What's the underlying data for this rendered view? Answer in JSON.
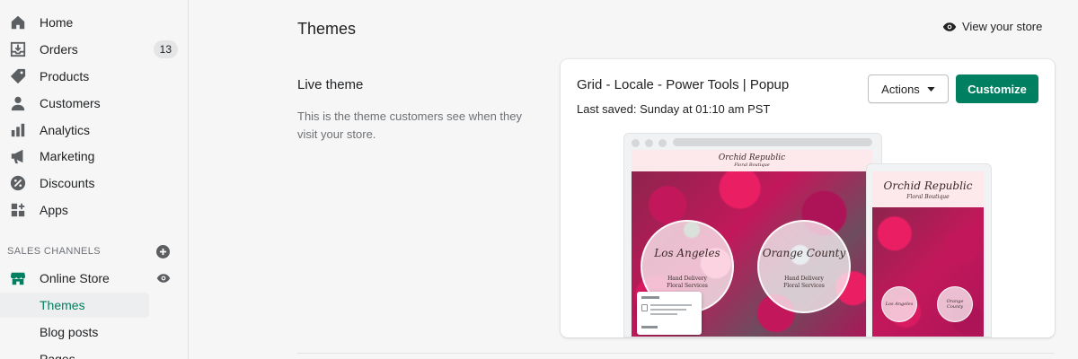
{
  "sidebar": {
    "items": [
      {
        "label": "Home",
        "icon": "home-icon"
      },
      {
        "label": "Orders",
        "icon": "orders-icon",
        "badge": "13"
      },
      {
        "label": "Products",
        "icon": "tag-icon"
      },
      {
        "label": "Customers",
        "icon": "person-icon"
      },
      {
        "label": "Analytics",
        "icon": "bar-chart-icon"
      },
      {
        "label": "Marketing",
        "icon": "megaphone-icon"
      },
      {
        "label": "Discounts",
        "icon": "discount-icon"
      },
      {
        "label": "Apps",
        "icon": "apps-icon"
      }
    ],
    "sales_channels_title": "SALES CHANNELS",
    "online_store": {
      "label": "Online Store",
      "icon": "store-icon"
    },
    "sub_items": [
      "Themes",
      "Blog posts",
      "Pages"
    ],
    "active_sub_item": "Themes"
  },
  "header": {
    "title": "Themes",
    "view_store": "View your store"
  },
  "live_theme": {
    "heading": "Live theme",
    "description": "This is the theme customers see when they visit your store."
  },
  "card": {
    "theme_name": "Grid - Locale - Power Tools | Popup",
    "last_saved": "Last saved: Sunday at 01:10 am PST",
    "actions_label": "Actions",
    "customize_label": "Customize"
  },
  "preview": {
    "logo": "Orchid Republic",
    "logo_sub": "Floral Boutique",
    "locations": [
      "Los Angeles",
      "Orange County"
    ],
    "location_sub": "Hand Delivery\nFloral Services"
  },
  "colors": {
    "accent": "#008060",
    "sidebar_bg": "#f6f6f7",
    "badge_bg": "#e4e5e7"
  }
}
